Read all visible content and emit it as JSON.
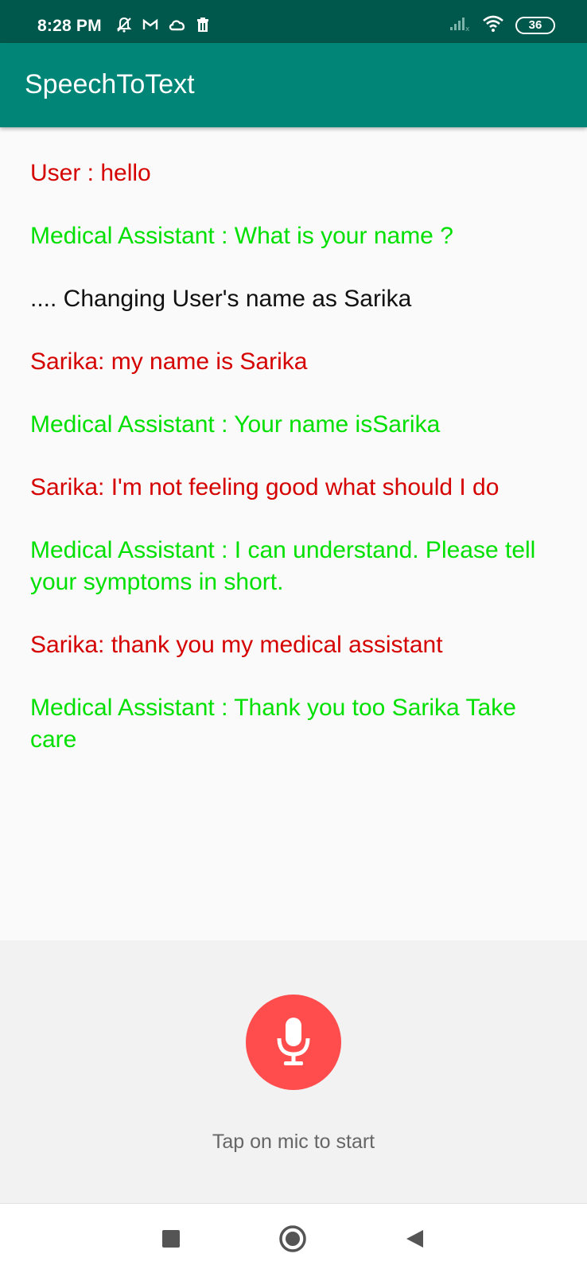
{
  "status_bar": {
    "time": "8:28 PM",
    "battery": "36",
    "left_icons": [
      "bell-off-icon",
      "gmail-icon",
      "cloud-icon",
      "trash-icon"
    ],
    "right_icons": [
      "signal-icon",
      "wifi-icon",
      "battery-icon"
    ]
  },
  "app_bar": {
    "title": "SpeechToText",
    "color": "#008577",
    "status_color": "#00574b"
  },
  "messages": [
    {
      "role": "user",
      "text": "User : hello"
    },
    {
      "role": "assistant",
      "text": "Medical Assistant : What is your name ?"
    },
    {
      "role": "system",
      "text": ".... Changing User's name as Sarika"
    },
    {
      "role": "user",
      "text": "Sarika: my name is Sarika"
    },
    {
      "role": "assistant",
      "text": "Medical Assistant : Your name isSarika"
    },
    {
      "role": "user",
      "text": "Sarika: I'm not feeling good what should I do"
    },
    {
      "role": "assistant",
      "text": "Medical Assistant : I can understand. Please tell your symptoms in short."
    },
    {
      "role": "user",
      "text": "Sarika: thank you my medical assistant"
    },
    {
      "role": "assistant",
      "text": "Medical Assistant : Thank you too Sarika Take care"
    }
  ],
  "colors": {
    "user": "#d50000",
    "assistant": "#00e000",
    "system": "#111111",
    "mic": "#ff4c4c"
  },
  "mic": {
    "icon": "microphone-icon",
    "hint": "Tap on mic to start"
  },
  "nav_bar": {
    "icons": [
      "recents-square-icon",
      "home-circle-icon",
      "back-triangle-icon"
    ]
  }
}
